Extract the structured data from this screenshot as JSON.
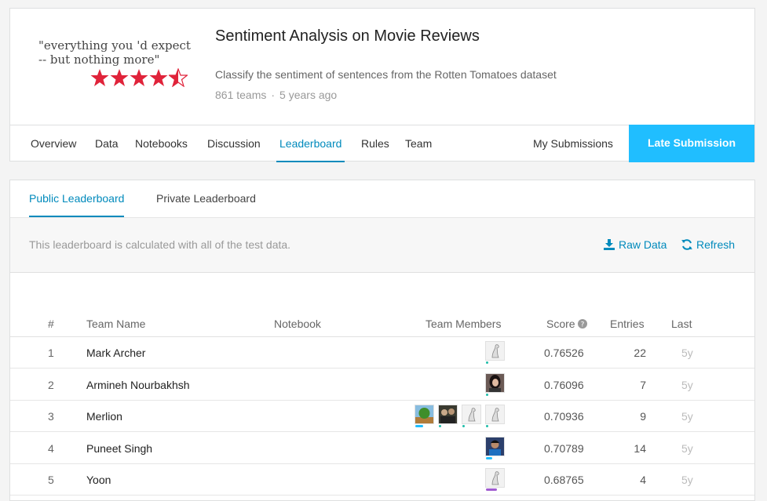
{
  "competition": {
    "banner_quote": "\"everything you 'd expect\n-- but nothing more\"",
    "title": "Sentiment Analysis on Movie Reviews",
    "subtitle": "Classify the sentiment of sentences from the Rotten Tomatoes dataset",
    "teams": "861 teams",
    "separator": "·",
    "age": "5 years ago",
    "star_color": "#e0233a"
  },
  "nav": {
    "items": [
      "Overview",
      "Data",
      "Notebooks",
      "Discussion",
      "Leaderboard",
      "Rules",
      "Team"
    ],
    "active": "Leaderboard",
    "my_submissions": "My Submissions",
    "late_submission": "Late Submission"
  },
  "leaderboard": {
    "tabs": [
      "Public Leaderboard",
      "Private Leaderboard"
    ],
    "active_tab": "Public Leaderboard",
    "info": "This leaderboard is calculated with all of the test data.",
    "raw_data": "Raw Data",
    "refresh": "Refresh",
    "columns": {
      "rank": "#",
      "team": "Team Name",
      "notebook": "Notebook",
      "members": "Team Members",
      "score": "Score",
      "entries": "Entries",
      "last": "Last"
    },
    "rows": [
      {
        "rank": "1",
        "team": "Mark Archer",
        "score": "0.76526",
        "entries": "22",
        "last": "5y",
        "members": [
          "default"
        ]
      },
      {
        "rank": "2",
        "team": "Armineh Nourbakhsh",
        "score": "0.76096",
        "entries": "7",
        "last": "5y",
        "members": [
          "person-dark-hair"
        ]
      },
      {
        "rank": "3",
        "team": "Merlion",
        "score": "0.70936",
        "entries": "9",
        "last": "5y",
        "members": [
          "tree",
          "group-photo",
          "default",
          "default"
        ]
      },
      {
        "rank": "4",
        "team": "Puneet Singh",
        "score": "0.70789",
        "entries": "14",
        "last": "5y",
        "members": [
          "person-blue"
        ]
      },
      {
        "rank": "5",
        "team": "Yoon",
        "score": "0.68765",
        "entries": "4",
        "last": "5y",
        "members": [
          "default"
        ]
      }
    ]
  }
}
